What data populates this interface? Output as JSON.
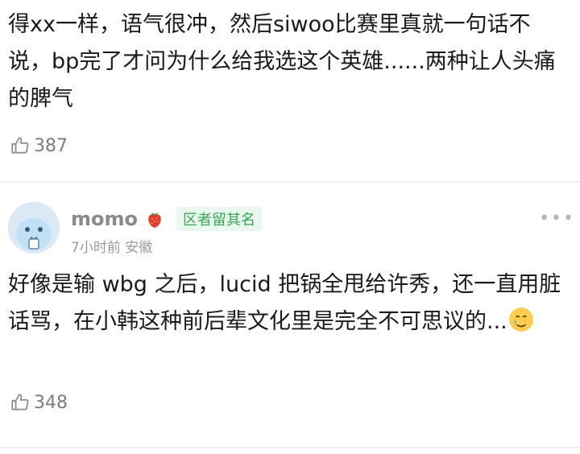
{
  "comment_1": {
    "text": "得xx一样，语气很冲，然后siwoo比赛里真就一句话不说，bp完了才问为什么给我选这个英雄......两种让人头痛的脾气",
    "likes": "387"
  },
  "comment_2": {
    "author": "momo",
    "badge": "区者留其名",
    "meta": "7小时前 安徽",
    "text_main": "好像是输 wbg 之后，lucid 把锅全甩给许秀，还一直用脏话骂，在小韩这种前后辈文化里是完全不可思议的...",
    "likes": "348"
  },
  "icons": {
    "like": "thumbs-up-icon",
    "more": "more-options-icon",
    "strawberry": "strawberry-icon",
    "emoji": "crying-smile-emoji"
  }
}
